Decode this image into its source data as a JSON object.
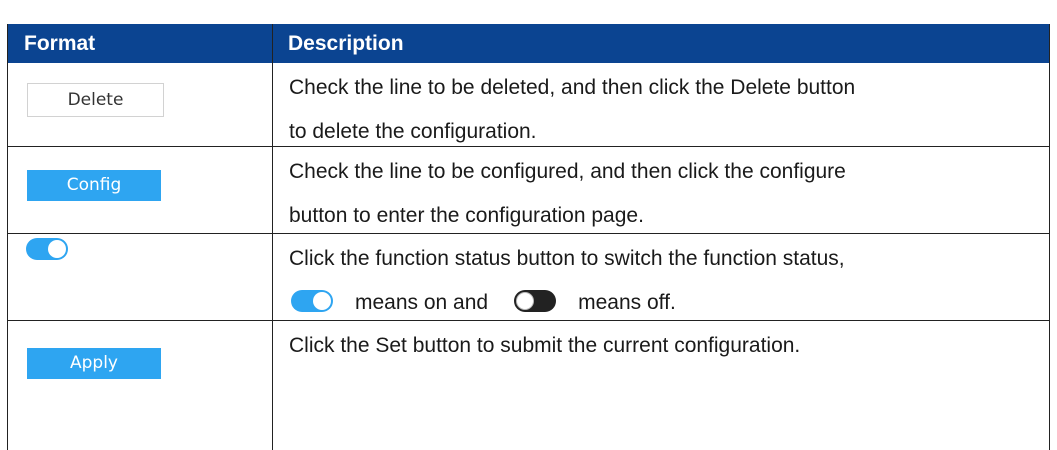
{
  "table": {
    "headers": {
      "format": "Format",
      "description": "Description"
    },
    "rows": [
      {
        "button_label": "Delete",
        "description_lines": [
          "Check the line to be deleted, and then click the Delete button",
          "to delete the configuration."
        ]
      },
      {
        "button_label": "Config",
        "description_lines": [
          "Check the line to be configured, and then click the configure",
          "button to enter the configuration page."
        ]
      },
      {
        "toggle_state": "on",
        "description_lines": [
          "Click the function status button to switch the function status,"
        ],
        "on_text": "means on and",
        "off_text": "means off."
      },
      {
        "button_label": "Apply",
        "description_lines": [
          "Click the Set button to submit the current configuration."
        ]
      }
    ]
  },
  "colors": {
    "header_bg": "#0b4491",
    "header_text": "#ffffff",
    "accent_blue": "#2ea5f1",
    "toggle_off": "#222222"
  }
}
